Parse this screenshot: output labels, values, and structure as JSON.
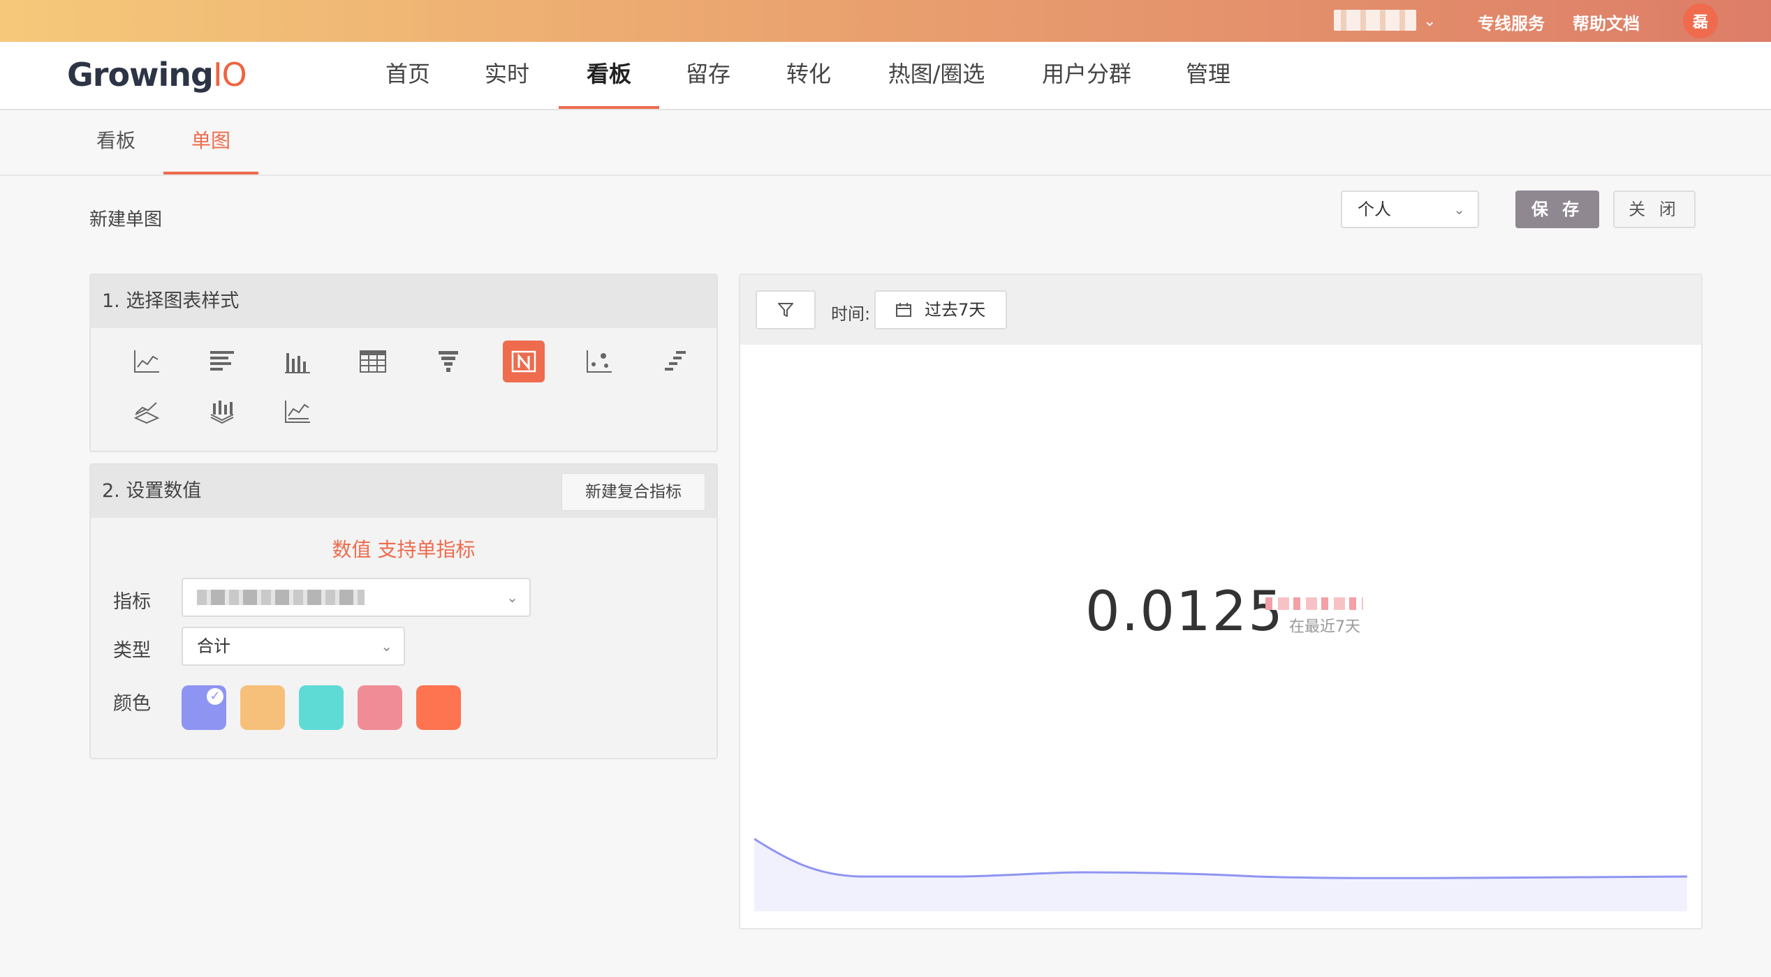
{
  "topbar": {
    "links": [
      "专线服务",
      "帮助文档"
    ],
    "avatar_text": "磊"
  },
  "nav": {
    "logo_main": "Growing",
    "logo_accent": "IO",
    "items": [
      "首页",
      "实时",
      "看板",
      "留存",
      "转化",
      "热图/圈选",
      "用户分群",
      "管理"
    ],
    "active": "看板"
  },
  "subtabs": {
    "items": [
      "看板",
      "单图"
    ],
    "active": "单图"
  },
  "page": {
    "title": "新建单图",
    "scope_value": "个人",
    "save_label": "保 存",
    "close_label": "关 闭"
  },
  "panel_style": {
    "title": "1. 选择图表样式",
    "icons": [
      "line-chart-icon",
      "bar-horizontal-icon",
      "bar-vertical-icon",
      "table-icon",
      "funnel-icon",
      "number-icon",
      "scatter-icon",
      "step-bar-icon",
      "stacked-line-icon",
      "stacked-bar-icon",
      "area-line-icon"
    ],
    "selected": "number-icon"
  },
  "panel_values": {
    "title": "2. 设置数值",
    "composite_button": "新建复合指标",
    "hint": "数值 支持单指标",
    "metric_label": "指标",
    "type_label": "类型",
    "type_value": "合计",
    "color_label": "颜色",
    "colors": [
      "#8e94f2",
      "#f6c07a",
      "#5fdbd6",
      "#f08c96",
      "#fe7350"
    ],
    "selected_color": "#8e94f2"
  },
  "chart_card": {
    "time_label": "时间:",
    "date_range": "过去7天",
    "value": "0.0125",
    "period_label": "在最近7天"
  }
}
